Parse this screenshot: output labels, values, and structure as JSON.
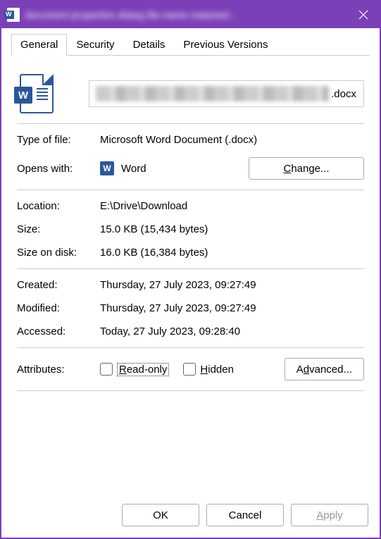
{
  "titlebar": {
    "title": "document properties dialog file-name redacted..."
  },
  "tabs": {
    "general": "General",
    "security": "Security",
    "details": "Details",
    "previous_versions": "Previous Versions"
  },
  "file": {
    "name_suffix": ".docx",
    "type_label": "Type of file:",
    "type_value": "Microsoft Word Document (.docx)",
    "opens_with_label": "Opens with:",
    "opens_with_app": "Word",
    "change_button": "Change...",
    "location_label": "Location:",
    "location_value": "E:\\Drive\\Download",
    "size_label": "Size:",
    "size_value": "15.0 KB (15,434 bytes)",
    "size_on_disk_label": "Size on disk:",
    "size_on_disk_value": "16.0 KB (16,384 bytes)",
    "created_label": "Created:",
    "created_value": "Thursday, 27 July 2023, 09:27:49",
    "modified_label": "Modified:",
    "modified_value": "Thursday, 27 July 2023, 09:27:49",
    "accessed_label": "Accessed:",
    "accessed_value": "Today, 27 July 2023, 09:28:40",
    "attributes_label": "Attributes:",
    "readonly_label": "Read-only",
    "hidden_label": "Hidden",
    "advanced_button": "Advanced..."
  },
  "footer": {
    "ok": "OK",
    "cancel": "Cancel",
    "apply": "Apply"
  }
}
